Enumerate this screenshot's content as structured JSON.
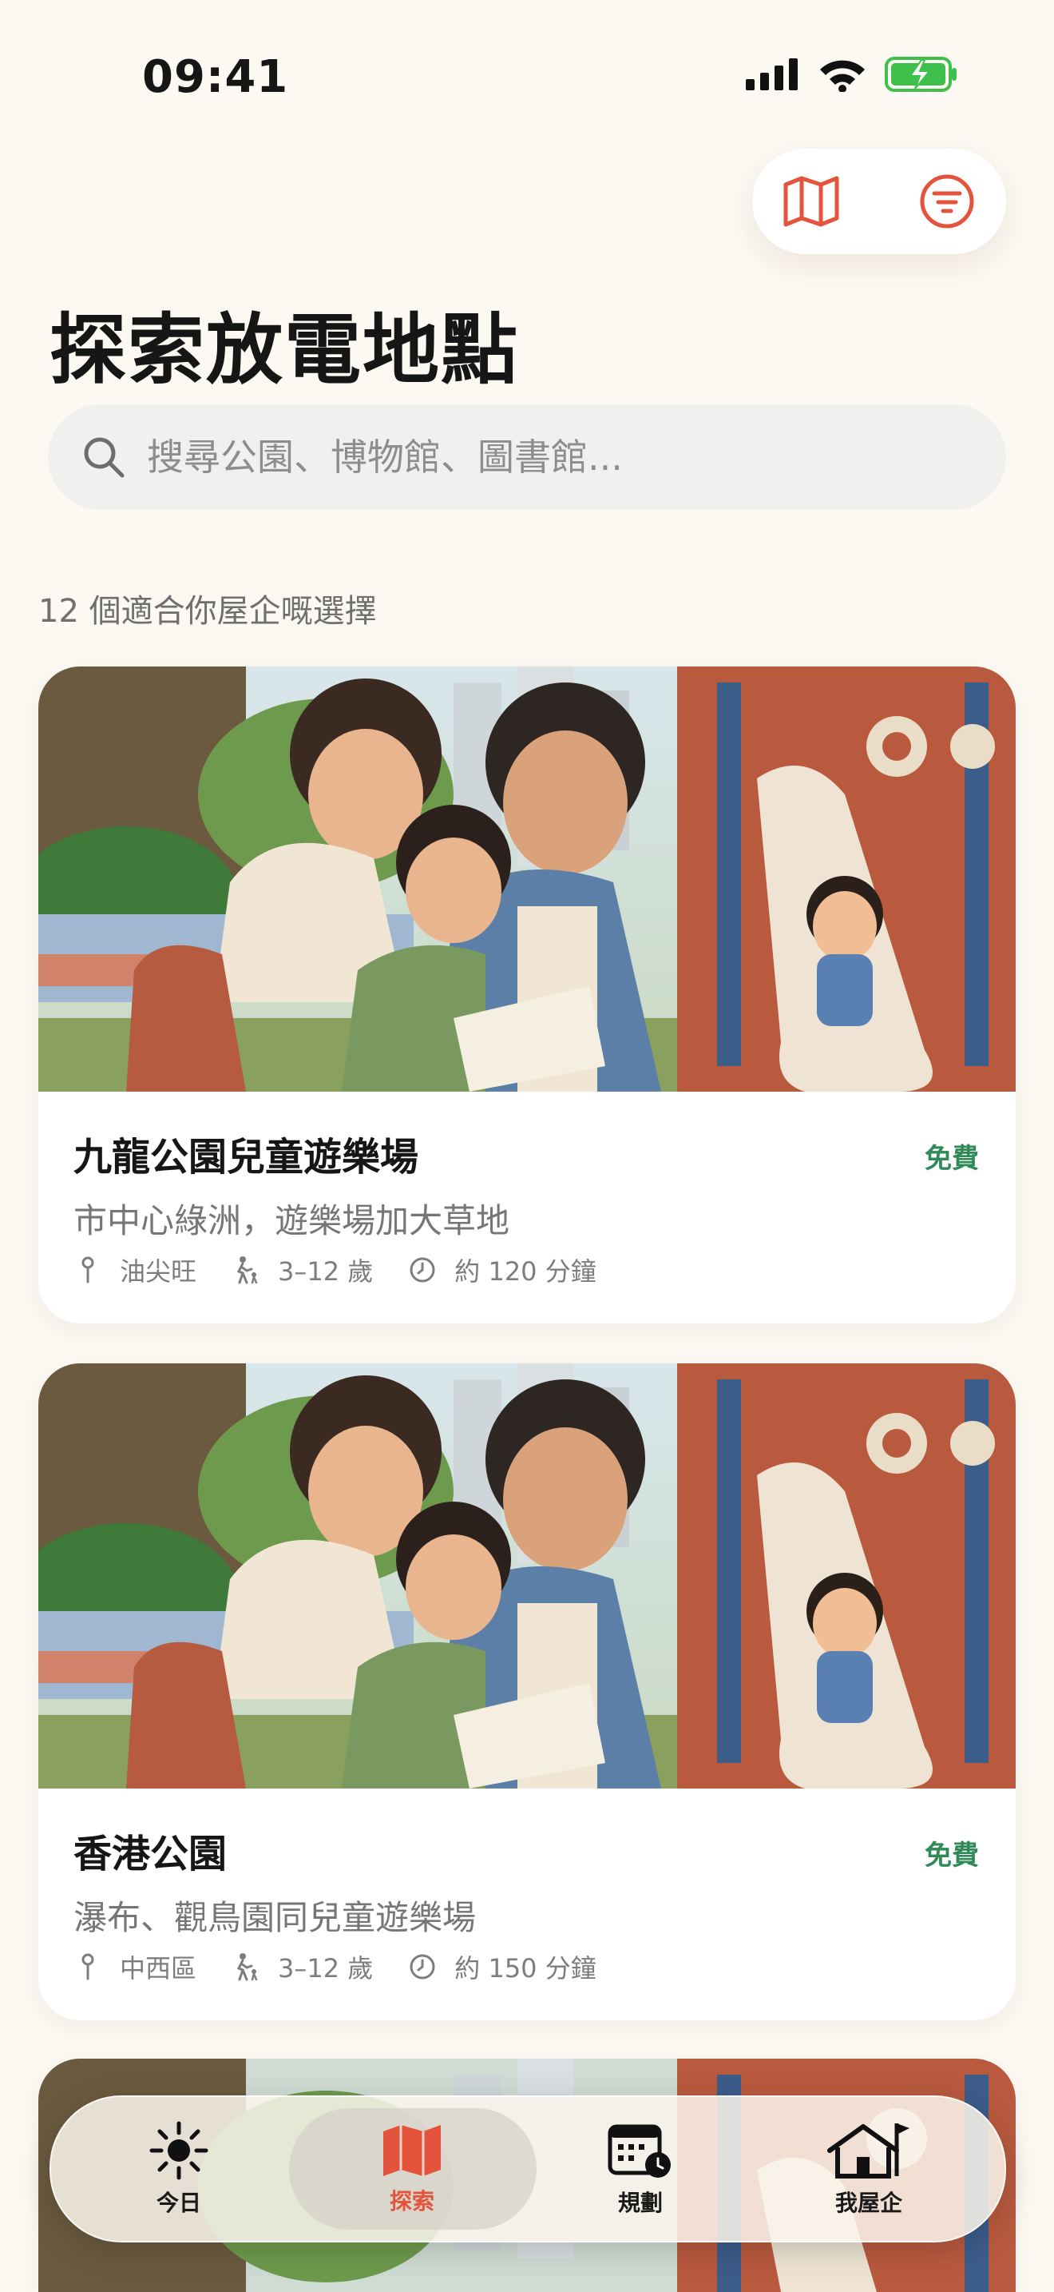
{
  "status_bar": {
    "time": "09:41"
  },
  "title": "探索放電地點",
  "search": {
    "placeholder": "搜尋公園、博物館、圖書館..."
  },
  "results_count": "12 個適合你屋企嘅選擇",
  "cards": [
    {
      "name": "九龍公園兒童遊樂場",
      "badge": "免費",
      "description": "市中心綠洲，遊樂場加大草地",
      "district": "油尖旺",
      "age": "3–12 歲",
      "duration": "約 120 分鐘"
    },
    {
      "name": "香港公園",
      "badge": "免費",
      "description": "瀑布、觀鳥園同兒童遊樂場",
      "district": "中西區",
      "age": "3–12 歲",
      "duration": "約 150 分鐘"
    }
  ],
  "tabs": [
    {
      "label": "今日",
      "icon": "sun-icon"
    },
    {
      "label": "探索",
      "icon": "map-icon"
    },
    {
      "label": "規劃",
      "icon": "calendar-icon"
    },
    {
      "label": "我屋企",
      "icon": "home-icon"
    }
  ],
  "colors": {
    "accent": "#e4543c",
    "free_badge": "#2f8a57",
    "background": "#fcf9f3",
    "battery": "#3fbf4b"
  }
}
